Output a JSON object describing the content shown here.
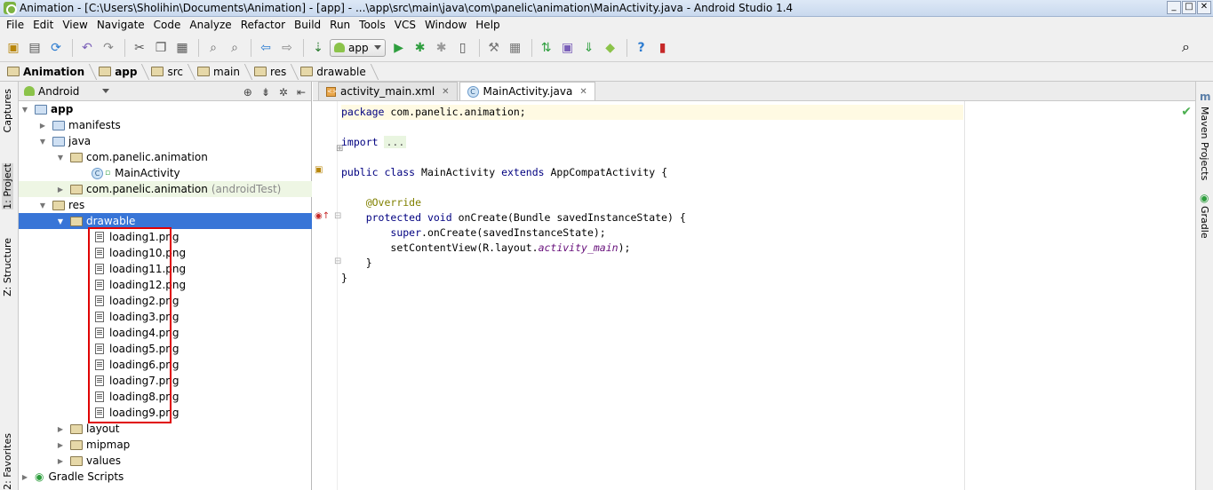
{
  "window": {
    "title": "Animation - [C:\\Users\\Sholihin\\Documents\\Animation] - [app] - ...\\app\\src\\main\\java\\com\\panelic\\animation\\MainActivity.java - Android Studio 1.4",
    "controls": [
      "_",
      "□",
      "✕"
    ]
  },
  "menu": [
    "File",
    "Edit",
    "View",
    "Navigate",
    "Code",
    "Analyze",
    "Refactor",
    "Build",
    "Run",
    "Tools",
    "VCS",
    "Window",
    "Help"
  ],
  "toolbar": {
    "run_config": "app"
  },
  "breadcrumb": [
    "Animation",
    "app",
    "src",
    "main",
    "res",
    "drawable"
  ],
  "left_tabs": [
    "Captures",
    "1: Project",
    "Z: Structure",
    "2: Favorites"
  ],
  "right_tabs": [
    "Maven Projects",
    "Gradle"
  ],
  "project": {
    "view": "Android",
    "tree": [
      {
        "label": "app",
        "bold": true
      },
      {
        "label": "manifests"
      },
      {
        "label": "java"
      },
      {
        "label": "com.panelic.animation"
      },
      {
        "label": "MainActivity"
      },
      {
        "label": "com.panelic.animation",
        "suffix": "(androidTest)"
      },
      {
        "label": "res"
      },
      {
        "label": "drawable"
      },
      {
        "label": "loading1.png"
      },
      {
        "label": "loading10.png"
      },
      {
        "label": "loading11.png"
      },
      {
        "label": "loading12.png"
      },
      {
        "label": "loading2.png"
      },
      {
        "label": "loading3.png"
      },
      {
        "label": "loading4.png"
      },
      {
        "label": "loading5.png"
      },
      {
        "label": "loading6.png"
      },
      {
        "label": "loading7.png"
      },
      {
        "label": "loading8.png"
      },
      {
        "label": "loading9.png"
      },
      {
        "label": "layout"
      },
      {
        "label": "mipmap"
      },
      {
        "label": "values"
      },
      {
        "label": "Gradle Scripts"
      }
    ]
  },
  "editor": {
    "tabs": [
      {
        "label": "activity_main.xml",
        "active": false
      },
      {
        "label": "MainActivity.java",
        "active": true
      }
    ],
    "code": {
      "l1_kw": "package",
      "l1_rest": " com.panelic.animation;",
      "l3_kw": "import",
      "l3_fold": "...",
      "l5_kw1": "public",
      "l5_kw2": "class",
      "l5_name": "MainActivity",
      "l5_kw3": "extends",
      "l5_rest": "AppCompatActivity {",
      "l7_ann": "@Override",
      "l8_kw1": "protected",
      "l8_kw2": "void",
      "l8_rest": " onCreate(Bundle savedInstanceState) {",
      "l9_kw": "super",
      "l9_rest": ".onCreate(savedInstanceState);",
      "l10_a": "setContentView(R.layout.",
      "l10_fld": "activity_main",
      "l10_b": ");",
      "l11": "}",
      "l12": "}"
    }
  }
}
